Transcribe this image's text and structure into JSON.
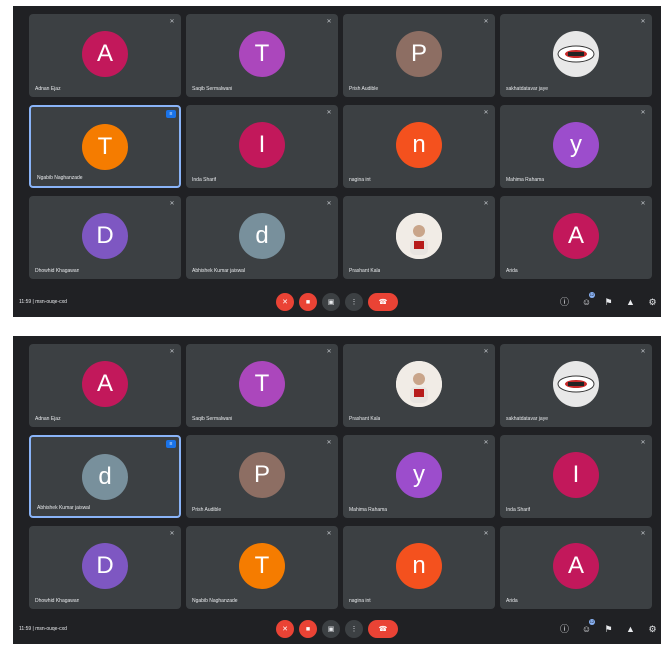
{
  "screenshots": [
    {
      "tiles": [
        {
          "initial": "A",
          "color": "#c2185b",
          "name": "Adnan Ejaz",
          "muted": true
        },
        {
          "initial": "T",
          "color": "#ab47bc",
          "name": "Saqib Sermalwani",
          "muted": true
        },
        {
          "initial": "P",
          "color": "#8d6e63",
          "name": "Prish Audible",
          "muted": true
        },
        {
          "initial": "",
          "color": "#e8e8e8",
          "photo": "logo",
          "name": "sakhatdatavar jaye",
          "muted": true
        },
        {
          "initial": "T",
          "color": "#f57c00",
          "name": "Ngabib Naghanzade",
          "speaking": true
        },
        {
          "initial": "I",
          "color": "#c2185b",
          "name": "Inda Sharif",
          "muted": true
        },
        {
          "initial": "n",
          "color": "#f4511e",
          "name": "nagina int",
          "muted": true
        },
        {
          "initial": "y",
          "color": "#9c4dcc",
          "name": "Mahima Rahama",
          "muted": true
        },
        {
          "initial": "D",
          "color": "#7e57c2",
          "name": "Dhowhid Khagawan",
          "muted": true
        },
        {
          "initial": "d",
          "color": "#78909c",
          "name": "Abhishek Kumar jaiswal",
          "muted": true
        },
        {
          "initial": "",
          "color": "#e8e8e8",
          "photo": "person",
          "name": "Prashant Kala",
          "muted": true
        },
        {
          "initial": "A",
          "color": "#c2185b",
          "name": "Arida",
          "muted": true
        }
      ],
      "meeting_info": "11:59 | msn-ouqe-cxd",
      "right_badge": "12"
    },
    {
      "tiles": [
        {
          "initial": "A",
          "color": "#c2185b",
          "name": "Adnan Ejaz",
          "muted": true
        },
        {
          "initial": "T",
          "color": "#ab47bc",
          "name": "Saqib Sermalwani",
          "muted": true
        },
        {
          "initial": "",
          "color": "#e8e8e8",
          "photo": "person",
          "name": "Prashant Kala",
          "muted": true
        },
        {
          "initial": "",
          "color": "#e8e8e8",
          "photo": "logo",
          "name": "sakhatdatavar jaye",
          "muted": true
        },
        {
          "initial": "d",
          "color": "#78909c",
          "name": "Abhishek Kumar jaiswal",
          "speaking": true
        },
        {
          "initial": "P",
          "color": "#8d6e63",
          "name": "Prish Audible",
          "muted": true
        },
        {
          "initial": "y",
          "color": "#9c4dcc",
          "name": "Mahima Rahama",
          "muted": true
        },
        {
          "initial": "I",
          "color": "#c2185b",
          "name": "Inda Sharif",
          "muted": true
        },
        {
          "initial": "D",
          "color": "#7e57c2",
          "name": "Dhowhid Khagawan",
          "muted": true
        },
        {
          "initial": "T",
          "color": "#f57c00",
          "name": "Ngabib Naghanzade",
          "muted": true
        },
        {
          "initial": "n",
          "color": "#f4511e",
          "name": "nagina int",
          "muted": true
        },
        {
          "initial": "A",
          "color": "#c2185b",
          "name": "Arida",
          "muted": true
        }
      ],
      "meeting_info": "11:59 | msn-ouqe-cxd",
      "right_badge": "12"
    }
  ],
  "icons": {
    "muted": "mic-off-icon",
    "speaking": "audio-levels-icon",
    "mic": "mic-off-icon",
    "camera": "camera-off-icon",
    "present": "present-screen-icon",
    "more": "more-options-icon",
    "end": "end-call-icon",
    "info": "info-icon",
    "people": "people-icon",
    "chat": "chat-icon",
    "activities": "activities-icon",
    "host": "host-controls-icon"
  }
}
